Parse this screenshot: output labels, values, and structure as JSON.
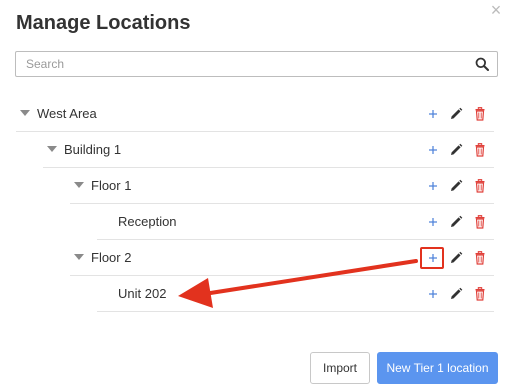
{
  "dialog": {
    "title": "Manage Locations",
    "close_glyph": "×"
  },
  "search": {
    "placeholder": "Search",
    "value": "",
    "icon": "search-icon"
  },
  "tree": [
    {
      "label": "West Area",
      "depth": 0,
      "expanded": true,
      "has_children": true
    },
    {
      "label": "Building 1",
      "depth": 1,
      "expanded": true,
      "has_children": true
    },
    {
      "label": "Floor 1",
      "depth": 2,
      "expanded": true,
      "has_children": true
    },
    {
      "label": "Reception",
      "depth": 3,
      "has_children": false
    },
    {
      "label": "Floor 2",
      "depth": 2,
      "expanded": true,
      "has_children": true
    },
    {
      "label": "Unit 202",
      "depth": 3,
      "has_children": false
    }
  ],
  "row_actions": {
    "add_icon": "plus-icon",
    "edit_icon": "pencil-icon",
    "delete_icon": "trash-icon"
  },
  "annotation": {
    "highlighted_action": "plus-icon",
    "highlighted_row": "Floor 2",
    "arrow_target_row": "Unit 202"
  },
  "footer": {
    "import_label": "Import",
    "new_label": "New Tier 1 location"
  },
  "colors": {
    "primary": "#5b95ef",
    "add_icon": "#4a7fd9",
    "edit_icon": "#333333",
    "delete_icon": "#e0403a",
    "annotation": "#e2321e",
    "divider": "#e3e3e3"
  }
}
